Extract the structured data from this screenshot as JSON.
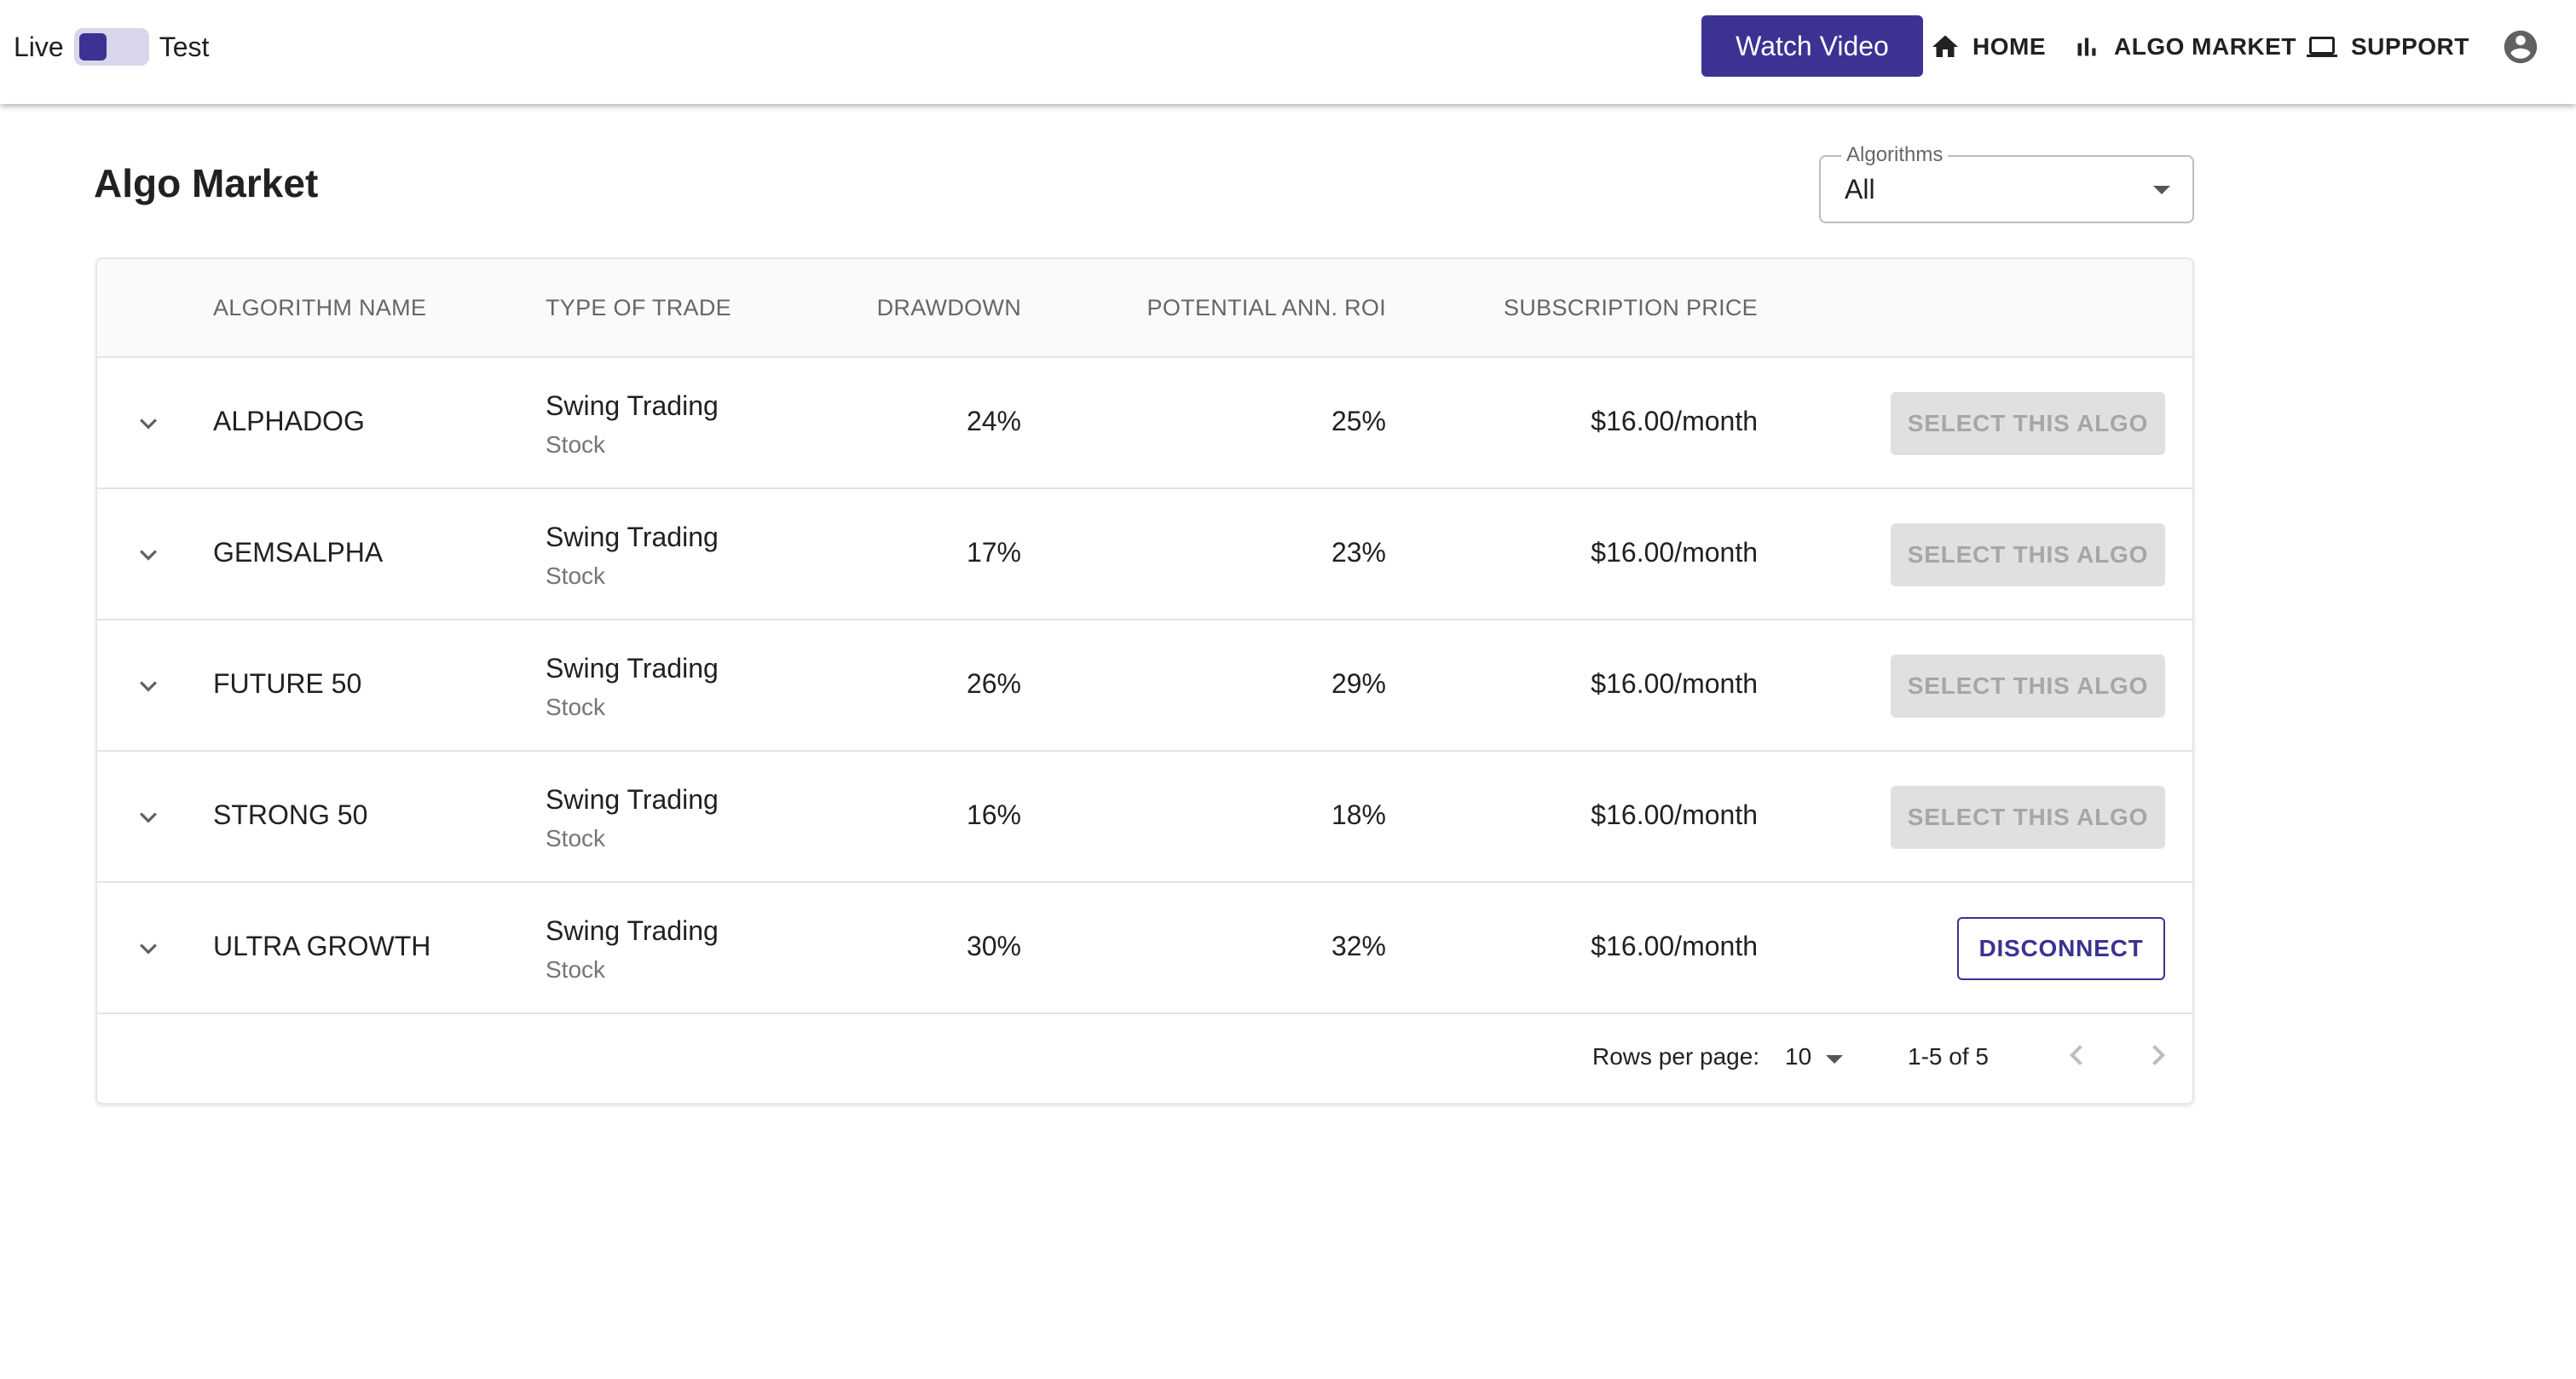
{
  "header": {
    "mode_left": "Live",
    "mode_right": "Test",
    "watch_video": "Watch Video",
    "nav": [
      {
        "label": "HOME",
        "icon": "home-icon"
      },
      {
        "label": "ALGO MARKET",
        "icon": "bar-chart-icon"
      },
      {
        "label": "SUPPORT",
        "icon": "laptop-icon"
      }
    ],
    "account_icon": "account-circle-icon"
  },
  "page": {
    "title": "Algo Market",
    "filter": {
      "label": "Algorithms",
      "value": "All"
    }
  },
  "table": {
    "columns": [
      "ALGORITHM NAME",
      "TYPE OF TRADE",
      "DRAWDOWN",
      "POTENTIAL ANN. ROI",
      "SUBSCRIPTION PRICE"
    ],
    "rows": [
      {
        "name": "ALPHADOG",
        "trade_type": "Swing Trading",
        "asset": "Stock",
        "drawdown": "24%",
        "roi": "25%",
        "price": "$16.00/month",
        "action": "SELECT THIS ALGO"
      },
      {
        "name": "GEMSALPHA",
        "trade_type": "Swing Trading",
        "asset": "Stock",
        "drawdown": "17%",
        "roi": "23%",
        "price": "$16.00/month",
        "action": "SELECT THIS ALGO"
      },
      {
        "name": "FUTURE 50",
        "trade_type": "Swing Trading",
        "asset": "Stock",
        "drawdown": "26%",
        "roi": "29%",
        "price": "$16.00/month",
        "action": "SELECT THIS ALGO"
      },
      {
        "name": "STRONG 50",
        "trade_type": "Swing Trading",
        "asset": "Stock",
        "drawdown": "16%",
        "roi": "18%",
        "price": "$16.00/month",
        "action": "SELECT THIS ALGO"
      },
      {
        "name": "ULTRA GROWTH",
        "trade_type": "Swing Trading",
        "asset": "Stock",
        "drawdown": "30%",
        "roi": "32%",
        "price": "$16.00/month",
        "action": "DISCONNECT"
      }
    ]
  },
  "pagination": {
    "rows_per_page_label": "Rows per page:",
    "rows_per_page": "10",
    "range": "1-5 of 5"
  },
  "colors": {
    "primary": "#3b3293",
    "switch_track": "#d8d6ea",
    "disabled_bg": "#e0e0e0",
    "disabled_text": "#a6a6a6"
  }
}
